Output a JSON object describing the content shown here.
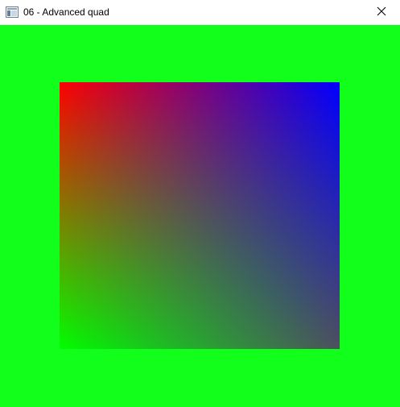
{
  "window": {
    "title": "06 - Advanced quad",
    "app_icon": "window-app-icon",
    "close_icon": "close-icon"
  },
  "scene": {
    "clear_color": "#12ff1b",
    "quad": {
      "corner_colors": {
        "top_left": "#ff0000",
        "top_right": "#0000ff",
        "bottom_left": "#00ff00",
        "bottom_right": "#4f4f5f"
      }
    }
  }
}
